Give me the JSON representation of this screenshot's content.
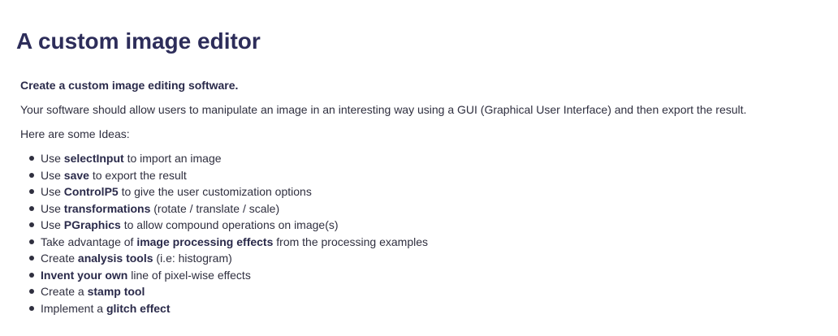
{
  "page": {
    "title": "A custom image editor",
    "intro_bold": "Create a custom image editing software.",
    "description": "Your software should allow users to manipulate an image in an interesting way using a GUI (Graphical User Interface) and then export the result.",
    "ideas_heading": "Here are some Ideas:"
  },
  "ideas": [
    {
      "pre": "Use ",
      "bold": "selectInput",
      "post": " to import an image"
    },
    {
      "pre": "Use ",
      "bold": "save",
      "post": " to export the result"
    },
    {
      "pre": "Use ",
      "bold": "ControlP5",
      "post": " to give the user customization options"
    },
    {
      "pre": "Use ",
      "bold": "transformations",
      "post": " (rotate / translate / scale)"
    },
    {
      "pre": "Use ",
      "bold": "PGraphics",
      "post": " to allow compound operations on image(s)"
    },
    {
      "pre": "Take advantage of ",
      "bold": "image processing effects",
      "post": " from the processing examples"
    },
    {
      "pre": "Create ",
      "bold": "analysis tools",
      "post": " (i.e: histogram)"
    },
    {
      "pre": "",
      "bold": "Invent your own",
      "post": " line of pixel-wise effects"
    },
    {
      "pre": "Create a ",
      "bold": "stamp tool",
      "post": ""
    },
    {
      "pre": "Implement a ",
      "bold": "glitch effect",
      "post": ""
    }
  ]
}
